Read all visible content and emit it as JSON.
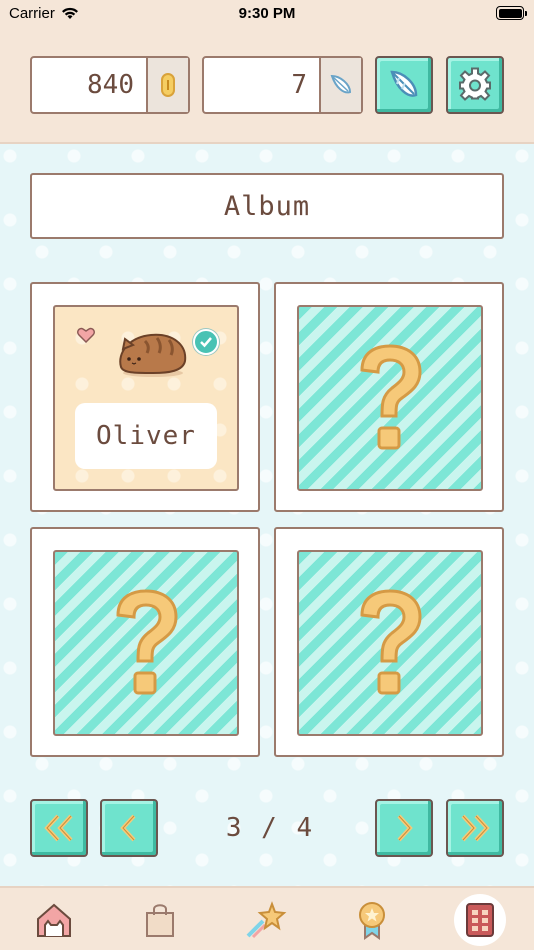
{
  "status_bar": {
    "carrier": "Carrier",
    "time": "9:30 PM"
  },
  "header": {
    "coins": "840",
    "feathers": "7",
    "coin_icon": "coin-icon",
    "feather_icon": "feather-icon",
    "settings_icon": "gear-icon"
  },
  "album": {
    "title": "Album",
    "cards": [
      {
        "unlocked": true,
        "name": "Oliver",
        "liked": true,
        "collected": true
      },
      {
        "unlocked": false,
        "name": ""
      },
      {
        "unlocked": false,
        "name": ""
      },
      {
        "unlocked": false,
        "name": ""
      }
    ],
    "locked_symbol": "?"
  },
  "pagination": {
    "current": 3,
    "total": 4,
    "label": "3 / 4"
  },
  "tabs": [
    {
      "icon": "cat-house-icon",
      "active": false
    },
    {
      "icon": "shopping-bag-icon",
      "active": false
    },
    {
      "icon": "shooting-star-icon",
      "active": false
    },
    {
      "icon": "medal-icon",
      "active": false
    },
    {
      "icon": "album-book-icon",
      "active": true
    }
  ],
  "colors": {
    "accent": "#6fe3cd",
    "header_bg": "#f5e6d8",
    "main_bg": "#e6f6f8",
    "border": "#9b7a6c",
    "text": "#6b4b3e"
  }
}
